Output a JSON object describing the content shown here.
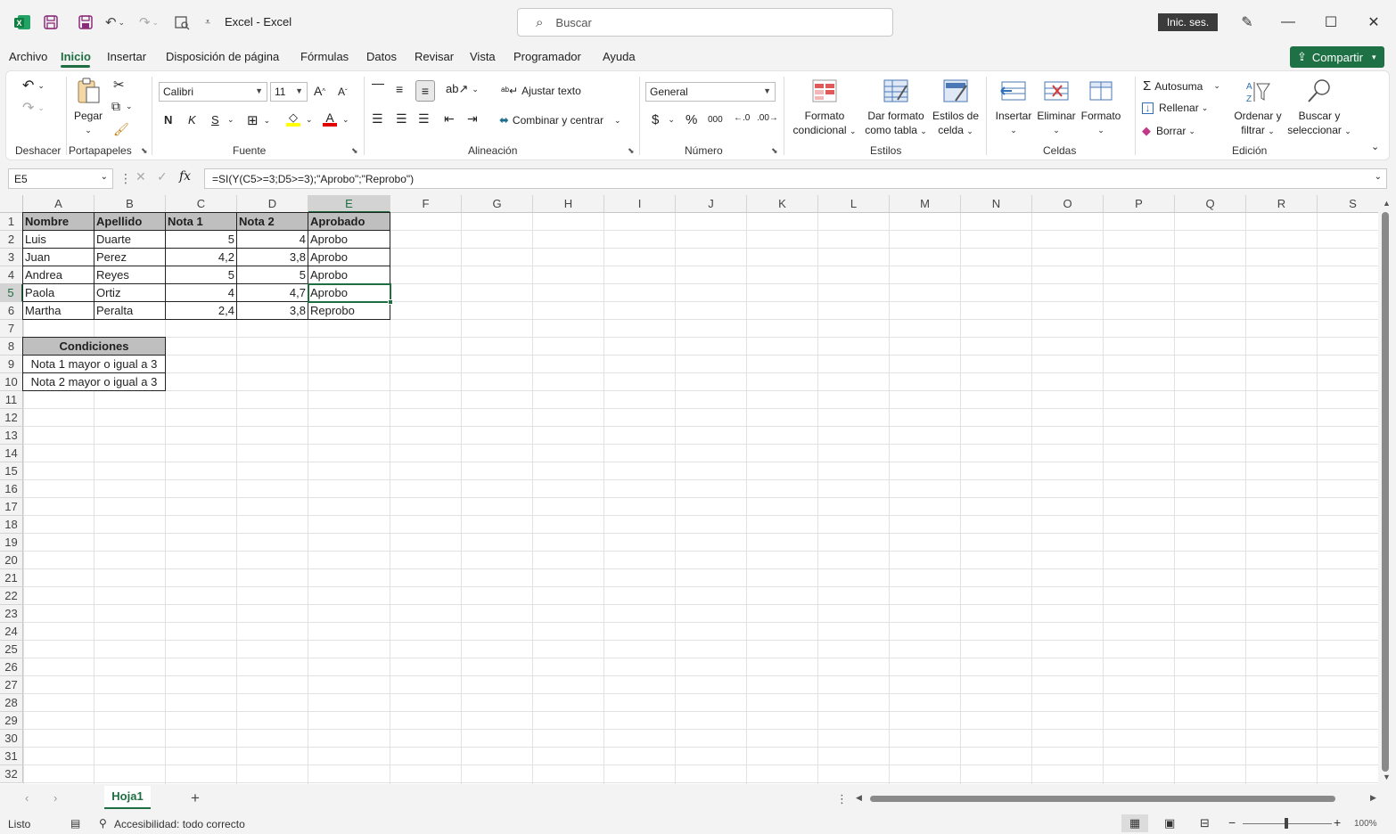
{
  "titlebar": {
    "title": "Excel  -  Excel",
    "search_placeholder": "Buscar",
    "signin_label": "Inic. ses."
  },
  "menu": {
    "tabs": [
      "Archivo",
      "Inicio",
      "Insertar",
      "Disposición de página",
      "Fórmulas",
      "Datos",
      "Revisar",
      "Vista",
      "Programador",
      "Ayuda"
    ],
    "active": "Inicio",
    "share_label": "Compartir"
  },
  "ribbon": {
    "groups": {
      "undo": "Deshacer",
      "clipboard": "Portapapeles",
      "font": "Fuente",
      "alignment": "Alineación",
      "number": "Número",
      "styles": "Estilos",
      "cells": "Celdas",
      "editing": "Edición"
    },
    "paste_label": "Pegar",
    "font_name": "Calibri",
    "font_size": "11",
    "bold": "N",
    "italic": "K",
    "underline": "S",
    "wrap_text": "Ajustar texto",
    "merge_center": "Combinar y centrar",
    "number_format": "General",
    "currency": "$",
    "percent": "%",
    "thousands": "000",
    "cond_format": [
      "Formato",
      "condicional"
    ],
    "format_table": [
      "Dar formato",
      "como tabla"
    ],
    "cell_styles": [
      "Estilos de",
      "celda"
    ],
    "insert": "Insertar",
    "delete": "Eliminar",
    "format": "Formato",
    "autosum": "Autosuma",
    "fill": "Rellenar",
    "clear": "Borrar",
    "sort_filter": [
      "Ordenar y",
      "filtrar"
    ],
    "find_select": [
      "Buscar y",
      "seleccionar"
    ]
  },
  "formula_bar": {
    "name_box": "E5",
    "fx": "fx",
    "formula": "=SI(Y(C5>=3;D5>=3);\"Aprobo\";\"Reprobo\")"
  },
  "sheet": {
    "columns": [
      "A",
      "B",
      "C",
      "D",
      "E",
      "F",
      "G",
      "H",
      "I",
      "J",
      "K",
      "L",
      "M",
      "N",
      "O",
      "P",
      "Q",
      "R",
      "S"
    ],
    "rows": [
      "1",
      "2",
      "3",
      "4",
      "5",
      "6",
      "7",
      "8",
      "9",
      "10",
      "11",
      "12",
      "13",
      "14",
      "15",
      "16",
      "17",
      "18",
      "19",
      "20",
      "21",
      "22",
      "23",
      "24",
      "25",
      "26",
      "27",
      "28",
      "29",
      "30",
      "31",
      "32"
    ],
    "table_header": [
      "Nombre",
      "Apellido",
      "Nota 1",
      "Nota 2",
      "Aprobado"
    ],
    "table_rows": [
      [
        "Luis",
        "Duarte",
        "5",
        "4",
        "Aprobo"
      ],
      [
        "Juan",
        "Perez",
        "4,2",
        "3,8",
        "Aprobo"
      ],
      [
        "Andrea",
        "Reyes",
        "5",
        "5",
        "Aprobo"
      ],
      [
        "Paola",
        "Ortiz",
        "4",
        "4,7",
        "Aprobo"
      ],
      [
        "Martha",
        "Peralta",
        "2,4",
        "3,8",
        "Reprobo"
      ]
    ],
    "conditions_title": "Condiciones",
    "conditions": [
      "Nota 1 mayor o igual a 3",
      "Nota 2 mayor o igual a 3"
    ],
    "selected_cell": "E5"
  },
  "tabs": {
    "sheet_name": "Hoja1"
  },
  "status": {
    "ready": "Listo",
    "accessibility": "Accesibilidad: todo correcto",
    "zoom": "100%"
  }
}
